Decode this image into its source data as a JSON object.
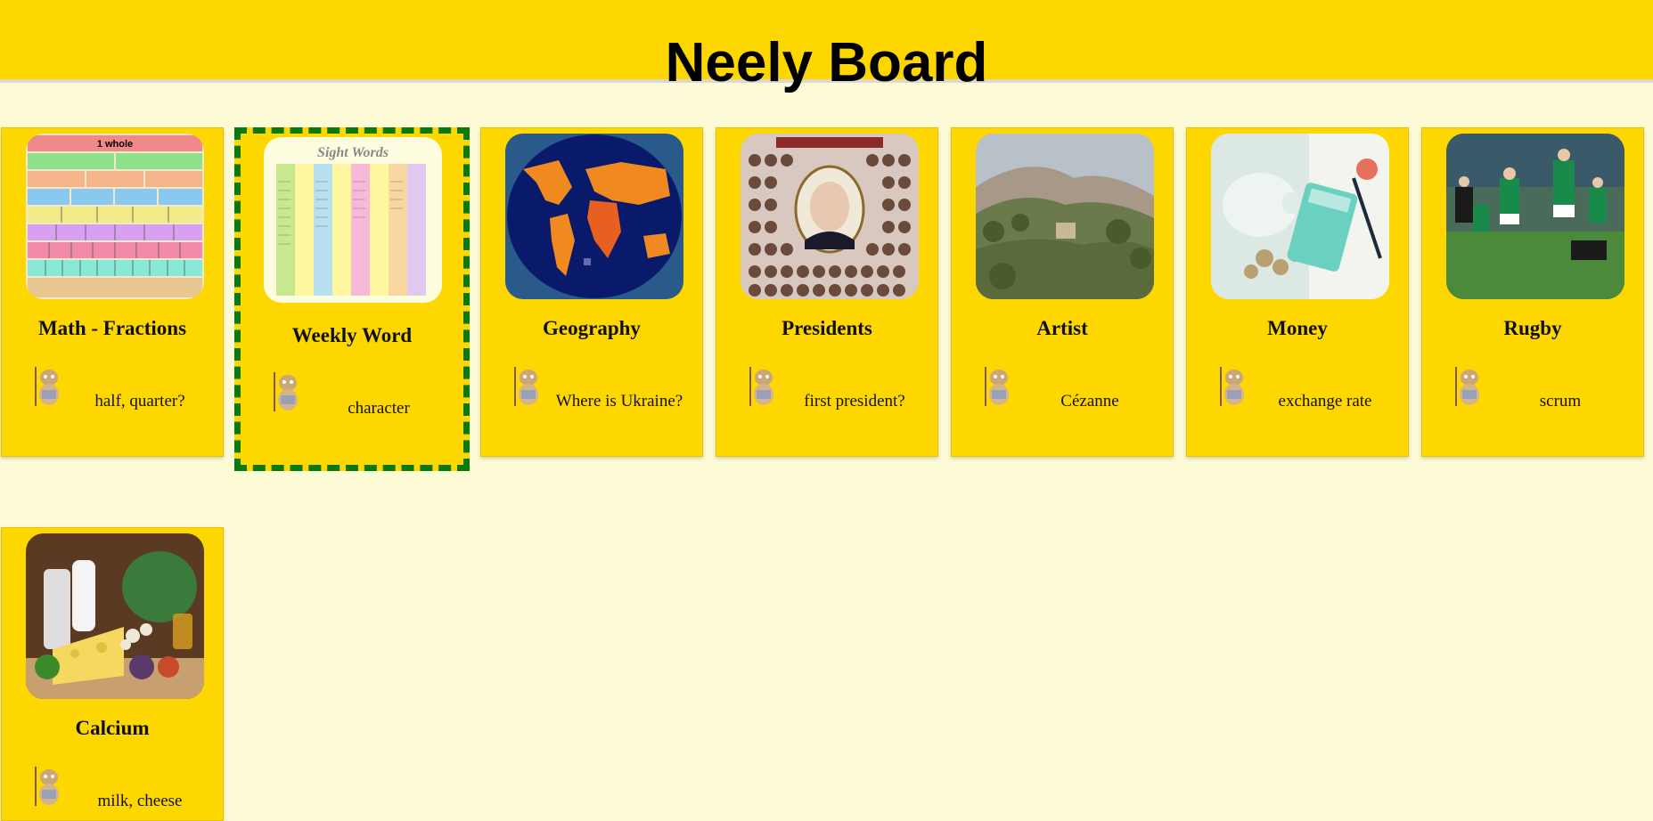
{
  "header": {
    "title": "Neely Board"
  },
  "cards": [
    {
      "title": "Math - Fractions",
      "note": "half, quarter?",
      "image": "fraction-chart-image"
    },
    {
      "title": "Weekly Word",
      "note": "character",
      "image": "sight-words-chart-image",
      "selected": true
    },
    {
      "title": "Geography",
      "note": "Where is Ukraine?",
      "image": "world-map-image"
    },
    {
      "title": "Presidents",
      "note": "first president?",
      "image": "presidents-poster-image"
    },
    {
      "title": "Artist",
      "note": "Cézanne",
      "image": "landscape-painting-image"
    },
    {
      "title": "Money",
      "note": "exchange rate",
      "image": "piggy-bank-calculator-image"
    },
    {
      "title": "Rugby",
      "note": "scrum",
      "image": "rugby-match-image"
    },
    {
      "title": "Calcium",
      "note": "milk, cheese",
      "image": "dairy-vegetables-image"
    }
  ],
  "sight_words": {
    "heading": "Sight Words"
  },
  "fractions_chart": {
    "top_label": "1 whole"
  },
  "colors": {
    "header": "#ffd700",
    "card": "#ffd700",
    "background": "#fdfbd5",
    "selected_border": "#0a7a0a"
  }
}
